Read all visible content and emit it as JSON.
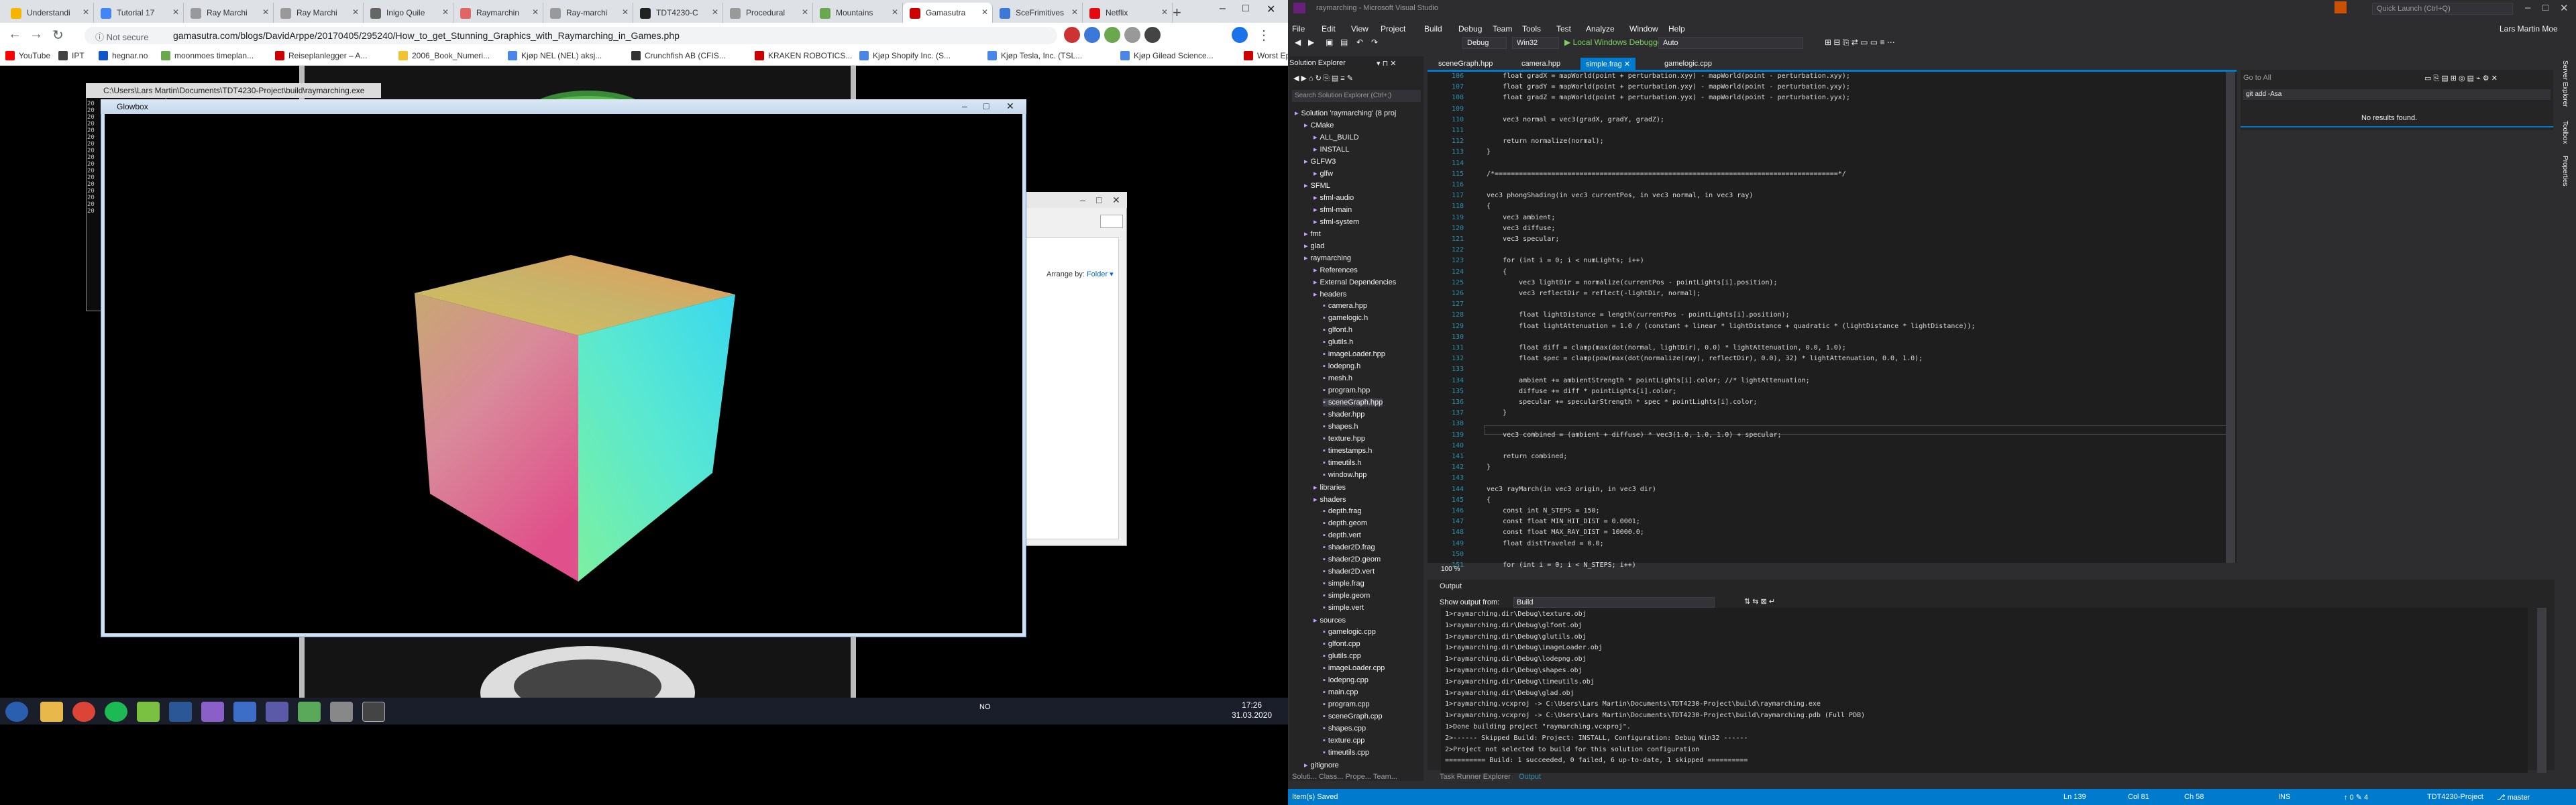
{
  "browser": {
    "tabs": [
      {
        "label": "Understandi",
        "color": "#f4b400"
      },
      {
        "label": "Tutorial 17",
        "color": "#4285f4"
      },
      {
        "label": "Ray Marchi",
        "color": "#999999"
      },
      {
        "label": "Ray Marchi",
        "color": "#999999"
      },
      {
        "label": "Inigo Quile",
        "color": "#666666"
      },
      {
        "label": "Raymarchin",
        "color": "#e06666"
      },
      {
        "label": "Ray-marchi",
        "color": "#999999"
      },
      {
        "label": "TDT4230-C",
        "color": "#222222"
      },
      {
        "label": "Procedural",
        "color": "#999999"
      },
      {
        "label": "Mountains",
        "color": "#6aa84f"
      },
      {
        "label": "Gamasutra",
        "color": "#cc0000"
      },
      {
        "label": "SceFrimitives",
        "color": "#3c78d8"
      },
      {
        "label": "Netflix",
        "color": "#e50914"
      }
    ],
    "active_tab_index": 10,
    "new_tab": "+",
    "window_min": "–",
    "window_max": "□",
    "window_close": "✕",
    "not_secure": "ⓘ Not secure",
    "url": "gamasutra.com/blogs/DavidArppe/20170405/295240/How_to_get_Stunning_Graphics_with_Raymarching_in_Games.php",
    "bookmarks": [
      {
        "label": "YouTube",
        "color": "#ff0000"
      },
      {
        "label": "IPT",
        "color": "#444444"
      },
      {
        "label": "hegnar.no",
        "color": "#1155cc"
      },
      {
        "label": "moonmoes timeplan...",
        "color": "#6aa84f"
      },
      {
        "label": "Reiseplanlegger – A...",
        "color": "#cc0000"
      },
      {
        "label": "2006_Book_Numeri...",
        "color": "#f1c232"
      },
      {
        "label": "Kjøp NEL (NEL) aksj...",
        "color": "#4a86e8"
      },
      {
        "label": "Crunchfish AB (CFIS...",
        "color": "#333333"
      },
      {
        "label": "KRAKEN ROBOTICS...",
        "color": "#cc0000"
      },
      {
        "label": "Kjøp Shopify Inc. (S...",
        "color": "#4a86e8"
      },
      {
        "label": "Kjøp Tesla, Inc. (TSL...",
        "color": "#4a86e8"
      },
      {
        "label": "Kjøp Gilead Science...",
        "color": "#4a86e8"
      },
      {
        "label": "Worst Episode Ever...",
        "color": "#cc0000"
      }
    ]
  },
  "console": {
    "title": "C:\\Users\\Lars Martin\\Documents\\TDT4230-Project\\build\\raymarching.exe",
    "lines": [
      "20",
      "20",
      "20",
      "20",
      "20",
      "20",
      "20",
      "20",
      "20",
      "20",
      "20",
      "20",
      "20",
      "20",
      "20",
      "20",
      "20"
    ]
  },
  "glowbox": {
    "title": "Glowbox",
    "min": "–",
    "max": "□",
    "close": "✕"
  },
  "explorer": {
    "arrange_by": "Arrange by:",
    "arrange_value": "Folder ▾"
  },
  "taskbar": {
    "tray_lang": "NO",
    "time": "17:26",
    "date": "31.03.2020"
  },
  "vs": {
    "title": "raymarching - Microsoft Visual Studio",
    "quick_launch": "Quick Launch (Ctrl+Q)",
    "user": "Lars Martin Moe",
    "menu": [
      "File",
      "Edit",
      "View",
      "Project",
      "Build",
      "Debug",
      "Team",
      "Tools",
      "Test",
      "Analyze",
      "Window",
      "Help"
    ],
    "toolbar": {
      "config": "Debug",
      "platform": "Win32",
      "debugger": "▶ Local Windows Debugger ▾",
      "auto": "Auto"
    },
    "solution_explorer": {
      "title": "Solution Explorer",
      "search_placeholder": "Search Solution Explorer (Ctrl+;)",
      "items": [
        {
          "label": "Solution 'raymarching' (8 proj",
          "indent": 0
        },
        {
          "label": "CMake",
          "indent": 1
        },
        {
          "label": "ALL_BUILD",
          "indent": 2
        },
        {
          "label": "INSTALL",
          "indent": 2
        },
        {
          "label": "GLFW3",
          "indent": 1
        },
        {
          "label": "glfw",
          "indent": 2
        },
        {
          "label": "SFML",
          "indent": 1
        },
        {
          "label": "sfml-audio",
          "indent": 2
        },
        {
          "label": "sfml-main",
          "indent": 2
        },
        {
          "label": "sfml-system",
          "indent": 2
        },
        {
          "label": "fmt",
          "indent": 1
        },
        {
          "label": "glad",
          "indent": 1
        },
        {
          "label": "raymarching",
          "indent": 1
        },
        {
          "label": "References",
          "indent": 2
        },
        {
          "label": "External Dependencies",
          "indent": 2
        },
        {
          "label": "headers",
          "indent": 2
        },
        {
          "label": "camera.hpp",
          "indent": 3
        },
        {
          "label": "gamelogic.h",
          "indent": 3
        },
        {
          "label": "glfont.h",
          "indent": 3
        },
        {
          "label": "glutils.h",
          "indent": 3
        },
        {
          "label": "imageLoader.hpp",
          "indent": 3
        },
        {
          "label": "lodepng.h",
          "indent": 3
        },
        {
          "label": "mesh.h",
          "indent": 3
        },
        {
          "label": "program.hpp",
          "indent": 3
        },
        {
          "label": "sceneGraph.hpp",
          "indent": 3
        },
        {
          "label": "shader.hpp",
          "indent": 3
        },
        {
          "label": "shapes.h",
          "indent": 3
        },
        {
          "label": "texture.hpp",
          "indent": 3
        },
        {
          "label": "timestamps.h",
          "indent": 3
        },
        {
          "label": "timeutils.h",
          "indent": 3
        },
        {
          "label": "window.hpp",
          "indent": 3
        },
        {
          "label": "libraries",
          "indent": 2
        },
        {
          "label": "shaders",
          "indent": 2
        },
        {
          "label": "depth.frag",
          "indent": 3
        },
        {
          "label": "depth.geom",
          "indent": 3
        },
        {
          "label": "depth.vert",
          "indent": 3
        },
        {
          "label": "shader2D.frag",
          "indent": 3
        },
        {
          "label": "shader2D.geom",
          "indent": 3
        },
        {
          "label": "shader2D.vert",
          "indent": 3
        },
        {
          "label": "simple.frag",
          "indent": 3
        },
        {
          "label": "simple.geom",
          "indent": 3
        },
        {
          "label": "simple.vert",
          "indent": 3
        },
        {
          "label": "sources",
          "indent": 2
        },
        {
          "label": "gamelogic.cpp",
          "indent": 3
        },
        {
          "label": "glfont.cpp",
          "indent": 3
        },
        {
          "label": "glutils.cpp",
          "indent": 3
        },
        {
          "label": "imageLoader.cpp",
          "indent": 3
        },
        {
          "label": "lodepng.cpp",
          "indent": 3
        },
        {
          "label": "main.cpp",
          "indent": 3
        },
        {
          "label": "program.cpp",
          "indent": 3
        },
        {
          "label": "sceneGraph.cpp",
          "indent": 3
        },
        {
          "label": "shapes.cpp",
          "indent": 3
        },
        {
          "label": "texture.cpp",
          "indent": 3
        },
        {
          "label": "timeutils.cpp",
          "indent": 3
        },
        {
          "label": "gitignore",
          "indent": 1
        }
      ],
      "selected_index": 24,
      "bottom_tabs": "Soluti...   Class...   Prope...   Team..."
    },
    "editor_tabs": [
      {
        "label": "sceneGraph.hpp",
        "active": false
      },
      {
        "label": "camera.hpp",
        "active": false
      },
      {
        "label": "simple.frag ✕",
        "active": true
      },
      {
        "label": "gamelogic.cpp",
        "active": false
      }
    ],
    "code": [
      {
        "n": "106",
        "t": "    float gradX = mapWorld(point + perturbation.xyy) - mapWorld(point - perturbation.xyy);"
      },
      {
        "n": "107",
        "t": "    float gradY = mapWorld(point + perturbation.yxy) - mapWorld(point - perturbation.yxy);"
      },
      {
        "n": "108",
        "t": "    float gradZ = mapWorld(point + perturbation.yyx) - mapWorld(point - perturbation.yyx);"
      },
      {
        "n": "109",
        "t": ""
      },
      {
        "n": "110",
        "t": "    vec3 normal = vec3(gradX, gradY, gradZ);"
      },
      {
        "n": "111",
        "t": ""
      },
      {
        "n": "112",
        "t": "    return normalize(normal);"
      },
      {
        "n": "113",
        "t": "}"
      },
      {
        "n": "114",
        "t": ""
      },
      {
        "n": "115",
        "t": "/*=====================================================================================*/"
      },
      {
        "n": "116",
        "t": ""
      },
      {
        "n": "117",
        "t": "vec3 phongShading(in vec3 currentPos, in vec3 normal, in vec3 ray)"
      },
      {
        "n": "118",
        "t": "{"
      },
      {
        "n": "119",
        "t": "    vec3 ambient;"
      },
      {
        "n": "120",
        "t": "    vec3 diffuse;"
      },
      {
        "n": "121",
        "t": "    vec3 specular;"
      },
      {
        "n": "122",
        "t": ""
      },
      {
        "n": "123",
        "t": "    for (int i = 0; i < numLights; i++)"
      },
      {
        "n": "124",
        "t": "    {"
      },
      {
        "n": "125",
        "t": "        vec3 lightDir = normalize(currentPos - pointLights[i].position);"
      },
      {
        "n": "126",
        "t": "        vec3 reflectDir = reflect(-lightDir, normal);"
      },
      {
        "n": "127",
        "t": ""
      },
      {
        "n": "128",
        "t": "        float lightDistance = length(currentPos - pointLights[i].position);"
      },
      {
        "n": "129",
        "t": "        float lightAttenuation = 1.0 / (constant + linear * lightDistance + quadratic * (lightDistance * lightDistance));"
      },
      {
        "n": "130",
        "t": ""
      },
      {
        "n": "131",
        "t": "        float diff = clamp(max(dot(normal, lightDir), 0.0) * lightAttenuation, 0.0, 1.0);"
      },
      {
        "n": "132",
        "t": "        float spec = clamp(pow(max(dot(normalize(ray), reflectDir), 0.0), 32) * lightAttenuation, 0.0, 1.0);"
      },
      {
        "n": "133",
        "t": ""
      },
      {
        "n": "134",
        "t": "        ambient += ambientStrength * pointLights[i].color; //* lightAttenuation;"
      },
      {
        "n": "135",
        "t": "        diffuse += diff * pointLights[i].color;"
      },
      {
        "n": "136",
        "t": "        specular += specularStrength * spec * pointLights[i].color;"
      },
      {
        "n": "137",
        "t": "    }"
      },
      {
        "n": "138",
        "t": ""
      },
      {
        "n": "139",
        "t": "    vec3 combined = (ambient + diffuse) * vec3(1.0, 1.0, 1.0) + specular;"
      },
      {
        "n": "140",
        "t": ""
      },
      {
        "n": "141",
        "t": "    return combined;"
      },
      {
        "n": "142",
        "t": "}"
      },
      {
        "n": "143",
        "t": ""
      },
      {
        "n": "144",
        "t": "vec3 rayMarch(in vec3 origin, in vec3 dir)"
      },
      {
        "n": "145",
        "t": "{"
      },
      {
        "n": "146",
        "t": "    const int N_STEPS = 150;"
      },
      {
        "n": "147",
        "t": "    const float MIN_HIT_DIST = 0.0001;"
      },
      {
        "n": "148",
        "t": "    const float MAX_RAY_DIST = 10000.0;"
      },
      {
        "n": "149",
        "t": "    float distTraveled = 0.0;"
      },
      {
        "n": "150",
        "t": ""
      },
      {
        "n": "151",
        "t": "    for (int i = 0; i < N_STEPS; i++)"
      }
    ],
    "zoom": "100 %",
    "find": {
      "title": "Go to All",
      "query": "git add -Asa",
      "result": "No results found."
    },
    "vertical_tabs": [
      "Server Explorer",
      "Toolbox",
      "Properties"
    ],
    "output": {
      "title": "Output",
      "show_from_label": "Show output from:",
      "show_from_value": "Build",
      "lines": [
        "1>raymarching.dir\\Debug\\texture.obj",
        "1>raymarching.dir\\Debug\\glfont.obj",
        "1>raymarching.dir\\Debug\\glutils.obj",
        "1>raymarching.dir\\Debug\\imageLoader.obj",
        "1>raymarching.dir\\Debug\\lodepng.obj",
        "1>raymarching.dir\\Debug\\shapes.obj",
        "1>raymarching.dir\\Debug\\timeutils.obj",
        "1>raymarching.dir\\Debug\\glad.obj",
        "1>raymarching.vcxproj -> C:\\Users\\Lars Martin\\Documents\\TDT4230-Project\\build\\raymarching.exe",
        "1>raymarching.vcxproj -> C:\\Users\\Lars Martin\\Documents\\TDT4230-Project\\build\\raymarching.pdb (Full PDB)",
        "1>Done building project \"raymarching.vcxproj\".",
        "2>------ Skipped Build: Project: INSTALL, Configuration: Debug Win32 ------",
        "2>Project not selected to build for this solution configuration",
        "========== Build: 1 succeeded, 0 failed, 6 up-to-date, 1 skipped =========="
      ],
      "tabs": [
        "Task Runner Explorer",
        "Output"
      ]
    },
    "status": {
      "left": "Item(s) Saved",
      "ln": "Ln 139",
      "col": "Col 81",
      "ch": "Ch 58",
      "ins": "INS",
      "arrows": "↑ 0   ✎ 4",
      "repo": "TDT4230-Project",
      "branch": "⎇ master"
    }
  },
  "colors": {
    "vs_accent": "#007acc",
    "vs_bg": "#2d2d30",
    "editor_bg": "#1e1e1e"
  }
}
